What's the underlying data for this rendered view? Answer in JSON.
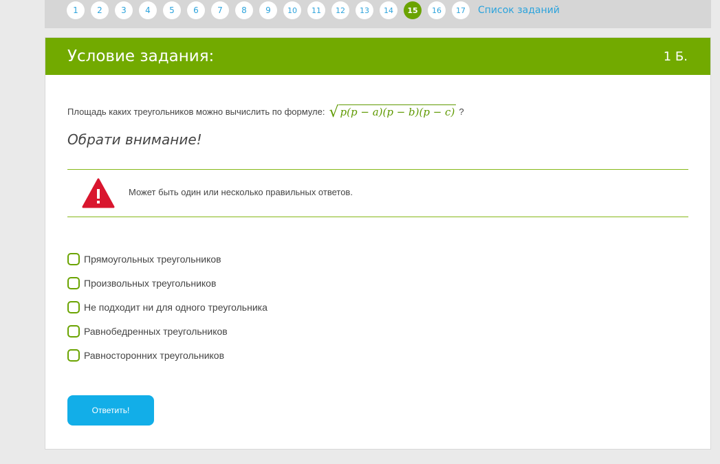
{
  "pagination": {
    "pages": [
      "1",
      "2",
      "3",
      "4",
      "5",
      "6",
      "7",
      "8",
      "9",
      "10",
      "11",
      "12",
      "13",
      "14",
      "15",
      "16",
      "17"
    ],
    "active_page": "15",
    "task_list_label": "Список заданий"
  },
  "card": {
    "title": "Условие задания:",
    "points": "1 Б.",
    "question_prefix": "Площадь каких треугольников можно вычислить по формуле:",
    "formula": "p(p − a)(p − b)(p − c)",
    "question_suffix": "?",
    "attention": "Обрати внимание!",
    "note": "Может быть один или несколько правильных ответов.",
    "options": [
      "Прямоугольных треугольников",
      "Произвольных треугольников",
      "Не подходит ни для одного треугольника",
      "Равнобедренных треугольников",
      "Равносторонних треугольников"
    ],
    "submit_label": "Ответить!"
  },
  "colors": {
    "header_green": "#72aa00",
    "active_page": "#6aa300",
    "link_blue": "#2ca3dc",
    "button_blue": "#12aee8",
    "warning_red": "#d9162e"
  },
  "icons": {
    "warning": "warning-triangle-icon",
    "checkbox": "checkbox-icon"
  }
}
